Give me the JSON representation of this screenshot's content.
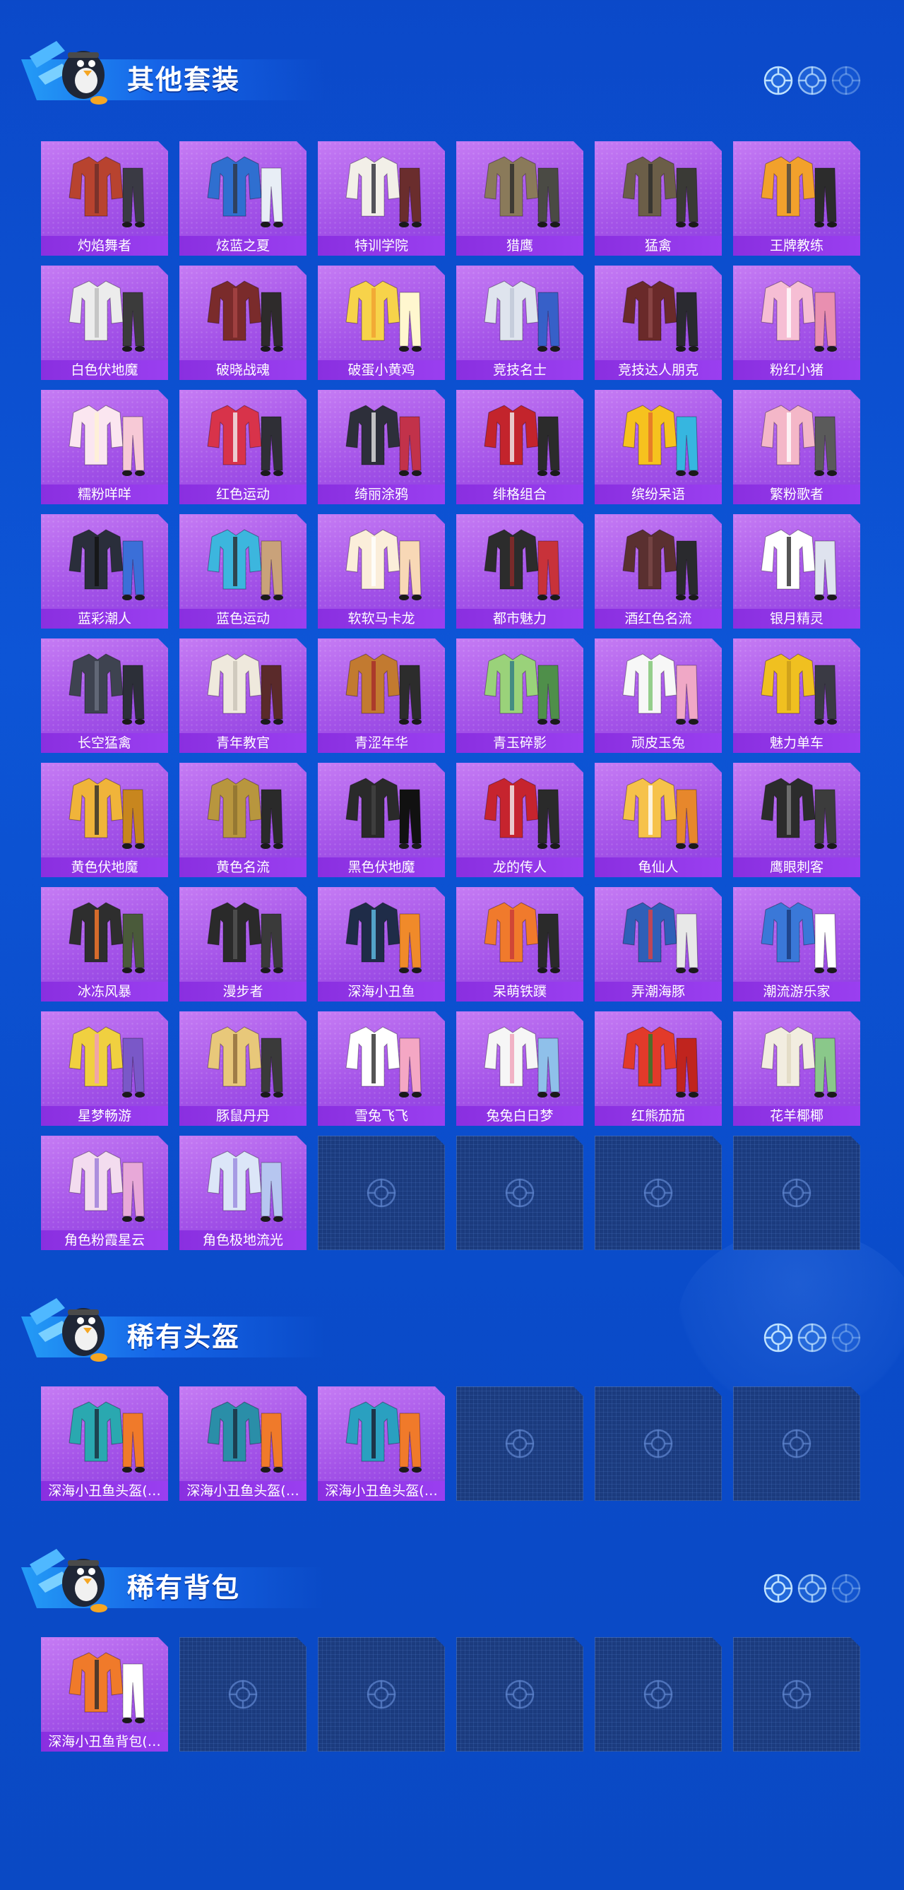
{
  "sections": [
    {
      "title": "其他套装",
      "items": [
        "灼焰舞者",
        "炫蓝之夏",
        "特训学院",
        "猎鹰",
        "猛禽",
        "王牌教练",
        "白色伏地魔",
        "破晓战魂",
        "破蛋小黄鸡",
        "竞技名士",
        "竞技达人朋克",
        "粉红小猪",
        "糯粉咩咩",
        "红色运动",
        "绮丽涂鸦",
        "绯格组合",
        "缤纷呆语",
        "繁粉歌者",
        "蓝彩潮人",
        "蓝色运动",
        "软软马卡龙",
        "都市魅力",
        "酒红色名流",
        "银月精灵",
        "长空猛禽",
        "青年教官",
        "青涩年华",
        "青玉碎影",
        "顽皮玉兔",
        "魅力单车",
        "黄色伏地魔",
        "黄色名流",
        "黑色伏地魔",
        "龙的传人",
        "龟仙人",
        "鹰眼刺客",
        "冰冻风暴",
        "漫步者",
        "深海小丑鱼",
        "呆萌铁蹼",
        "弄潮海豚",
        "潮流游乐家",
        "星梦畅游",
        "豚鼠丹丹",
        "雪兔飞飞",
        "兔兔白日梦",
        "红熊茄茄",
        "花羊椰椰",
        "角色粉霞星云",
        "角色极地流光"
      ],
      "empty_slots": 4
    },
    {
      "title": "稀有头盔",
      "items": [
        "深海小丑鱼头盔(…",
        "深海小丑鱼头盔(…",
        "深海小丑鱼头盔(…"
      ],
      "empty_slots": 3
    },
    {
      "title": "稀有背包",
      "items": [
        "深海小丑鱼背包(…"
      ],
      "empty_slots": 5
    }
  ],
  "colors": {
    "background": "#0b49c9",
    "card_purple": "#a453e8",
    "label_purple": "#8a2fe0",
    "empty_slot": "#1b3b7e"
  },
  "icons": {
    "mascot": "penguin-parachute-mascot-icon",
    "crosshair": "crosshair-icon",
    "slot": "crosshair-slot-icon"
  }
}
